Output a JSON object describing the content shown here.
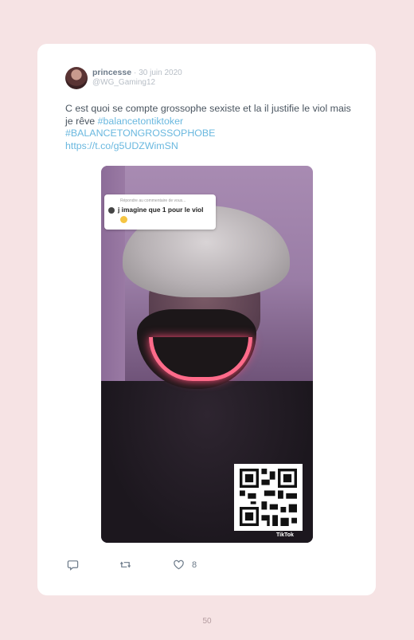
{
  "tweet": {
    "user_name": "princesse",
    "separator": "·",
    "date": "30 juin 2020",
    "handle": "@WG_Gaming12",
    "text_plain": "C est quoi se compte grossophe sexiste et la il justifie le viol mais je rêve ",
    "hashtag_1": "#balancetontiktoker",
    "hashtag_2": "#BALANCETONGROSSOPHOBE",
    "link": "https://t.co/g5UDZWimSN",
    "like_count": "8"
  },
  "media": {
    "caption_reply_text": "Répondre au commentaire de vous...",
    "caption_text": "j imagine que 1 pour le viol",
    "watermark": "TikTok"
  },
  "icons": {
    "reply": "reply-icon",
    "retweet": "retweet-icon",
    "like": "heart-icon"
  },
  "colors": {
    "link": "#6ab8df",
    "background": "#f6e3e4",
    "meta": "#b7bec6"
  },
  "page": {
    "number": "50"
  }
}
